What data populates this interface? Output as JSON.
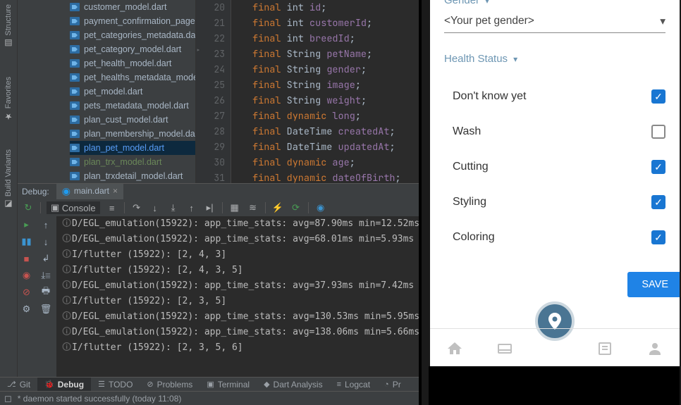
{
  "side_labels": {
    "structure": "Structure",
    "favorites": "Favorites",
    "build_variants": "Build Variants"
  },
  "tree": [
    {
      "name": "customer_model.dart",
      "sel": false,
      "lnk": false
    },
    {
      "name": "payment_confirmation_page..",
      "sel": false,
      "lnk": false
    },
    {
      "name": "pet_categories_metadata.dart",
      "sel": false,
      "lnk": false
    },
    {
      "name": "pet_category_model.dart",
      "sel": false,
      "lnk": false
    },
    {
      "name": "pet_health_model.dart",
      "sel": false,
      "lnk": false
    },
    {
      "name": "pet_healths_metadata_model",
      "sel": false,
      "lnk": false
    },
    {
      "name": "pet_model.dart",
      "sel": false,
      "lnk": false
    },
    {
      "name": "pets_metadata_model.dart",
      "sel": false,
      "lnk": false
    },
    {
      "name": "plan_cust_model.dart",
      "sel": false,
      "lnk": false
    },
    {
      "name": "plan_membership_model.dar",
      "sel": false,
      "lnk": false
    },
    {
      "name": "plan_pet_model.dart",
      "sel": true,
      "lnk": false
    },
    {
      "name": "plan_trx_model.dart",
      "sel": false,
      "lnk": true
    },
    {
      "name": "plan_trxdetail_model.dart",
      "sel": false,
      "lnk": false
    }
  ],
  "editor": {
    "first_line_no": 20,
    "lines": [
      {
        "t": "final ",
        "kw": true,
        "r": "int id;",
        "f": "id"
      },
      {
        "t": "final ",
        "kw": true,
        "r": "int customerId;",
        "f": "customerId"
      },
      {
        "t": "final ",
        "kw": true,
        "r": "int breedId;",
        "f": "breedId"
      },
      {
        "t": "final ",
        "kw": true,
        "r": "String petName;",
        "f": "petName"
      },
      {
        "t": "final ",
        "kw": true,
        "r": "String gender;",
        "f": "gender"
      },
      {
        "t": "final ",
        "kw": true,
        "r": "String image;",
        "f": "image"
      },
      {
        "t": "final ",
        "kw": true,
        "r": "String weight;",
        "f": "weight"
      },
      {
        "t": "final ",
        "kw": true,
        "r": "dynamic long;",
        "f": "long",
        "dynkw": true
      },
      {
        "t": "final ",
        "kw": true,
        "r": "DateTime createdAt;",
        "f": "createdAt"
      },
      {
        "t": "final ",
        "kw": true,
        "r": "DateTime updatedAt;",
        "f": "updatedAt"
      },
      {
        "t": "final ",
        "kw": true,
        "r": "dynamic age;",
        "f": "age",
        "dynkw": true
      },
      {
        "t": "final ",
        "kw": true,
        "r": "dynamic dateOfBirth.",
        "f": "dateOfBirth",
        "dynkw": true
      }
    ]
  },
  "debug": {
    "label": "Debug:",
    "tab": "main.dart",
    "console_label": "Console",
    "lines": [
      "D/EGL_emulation(15922): app_time_stats: avg=87.90ms min=12.52ms",
      "D/EGL_emulation(15922): app_time_stats: avg=68.01ms min=5.93ms",
      "I/flutter (15922): [2, 4, 3]",
      "I/flutter (15922): [2, 4, 3, 5]",
      "D/EGL_emulation(15922): app_time_stats: avg=37.93ms min=7.42ms",
      "I/flutter (15922): [2, 3, 5]",
      "D/EGL_emulation(15922): app_time_stats: avg=130.53ms min=5.95ms",
      "D/EGL_emulation(15922): app_time_stats: avg=138.06ms min=5.66ms",
      "I/flutter (15922): [2, 3, 5, 6]"
    ]
  },
  "bottom": {
    "git": "Git",
    "debug": "Debug",
    "todo": "TODO",
    "problems": "Problems",
    "terminal": "Terminal",
    "dart": "Dart Analysis",
    "logcat": "Logcat",
    "pr": "Pr"
  },
  "status": "* daemon started successfully (today 11:08)",
  "app": {
    "gender_label": "Gender",
    "gender_value": "<Your pet gender>",
    "health_label": "Health Status",
    "items": [
      {
        "label": "Don't know yet",
        "checked": true
      },
      {
        "label": "Wash",
        "checked": false
      },
      {
        "label": "Cutting",
        "checked": true
      },
      {
        "label": "Styling",
        "checked": true
      },
      {
        "label": "Coloring",
        "checked": true
      }
    ],
    "save": "SAVE"
  }
}
